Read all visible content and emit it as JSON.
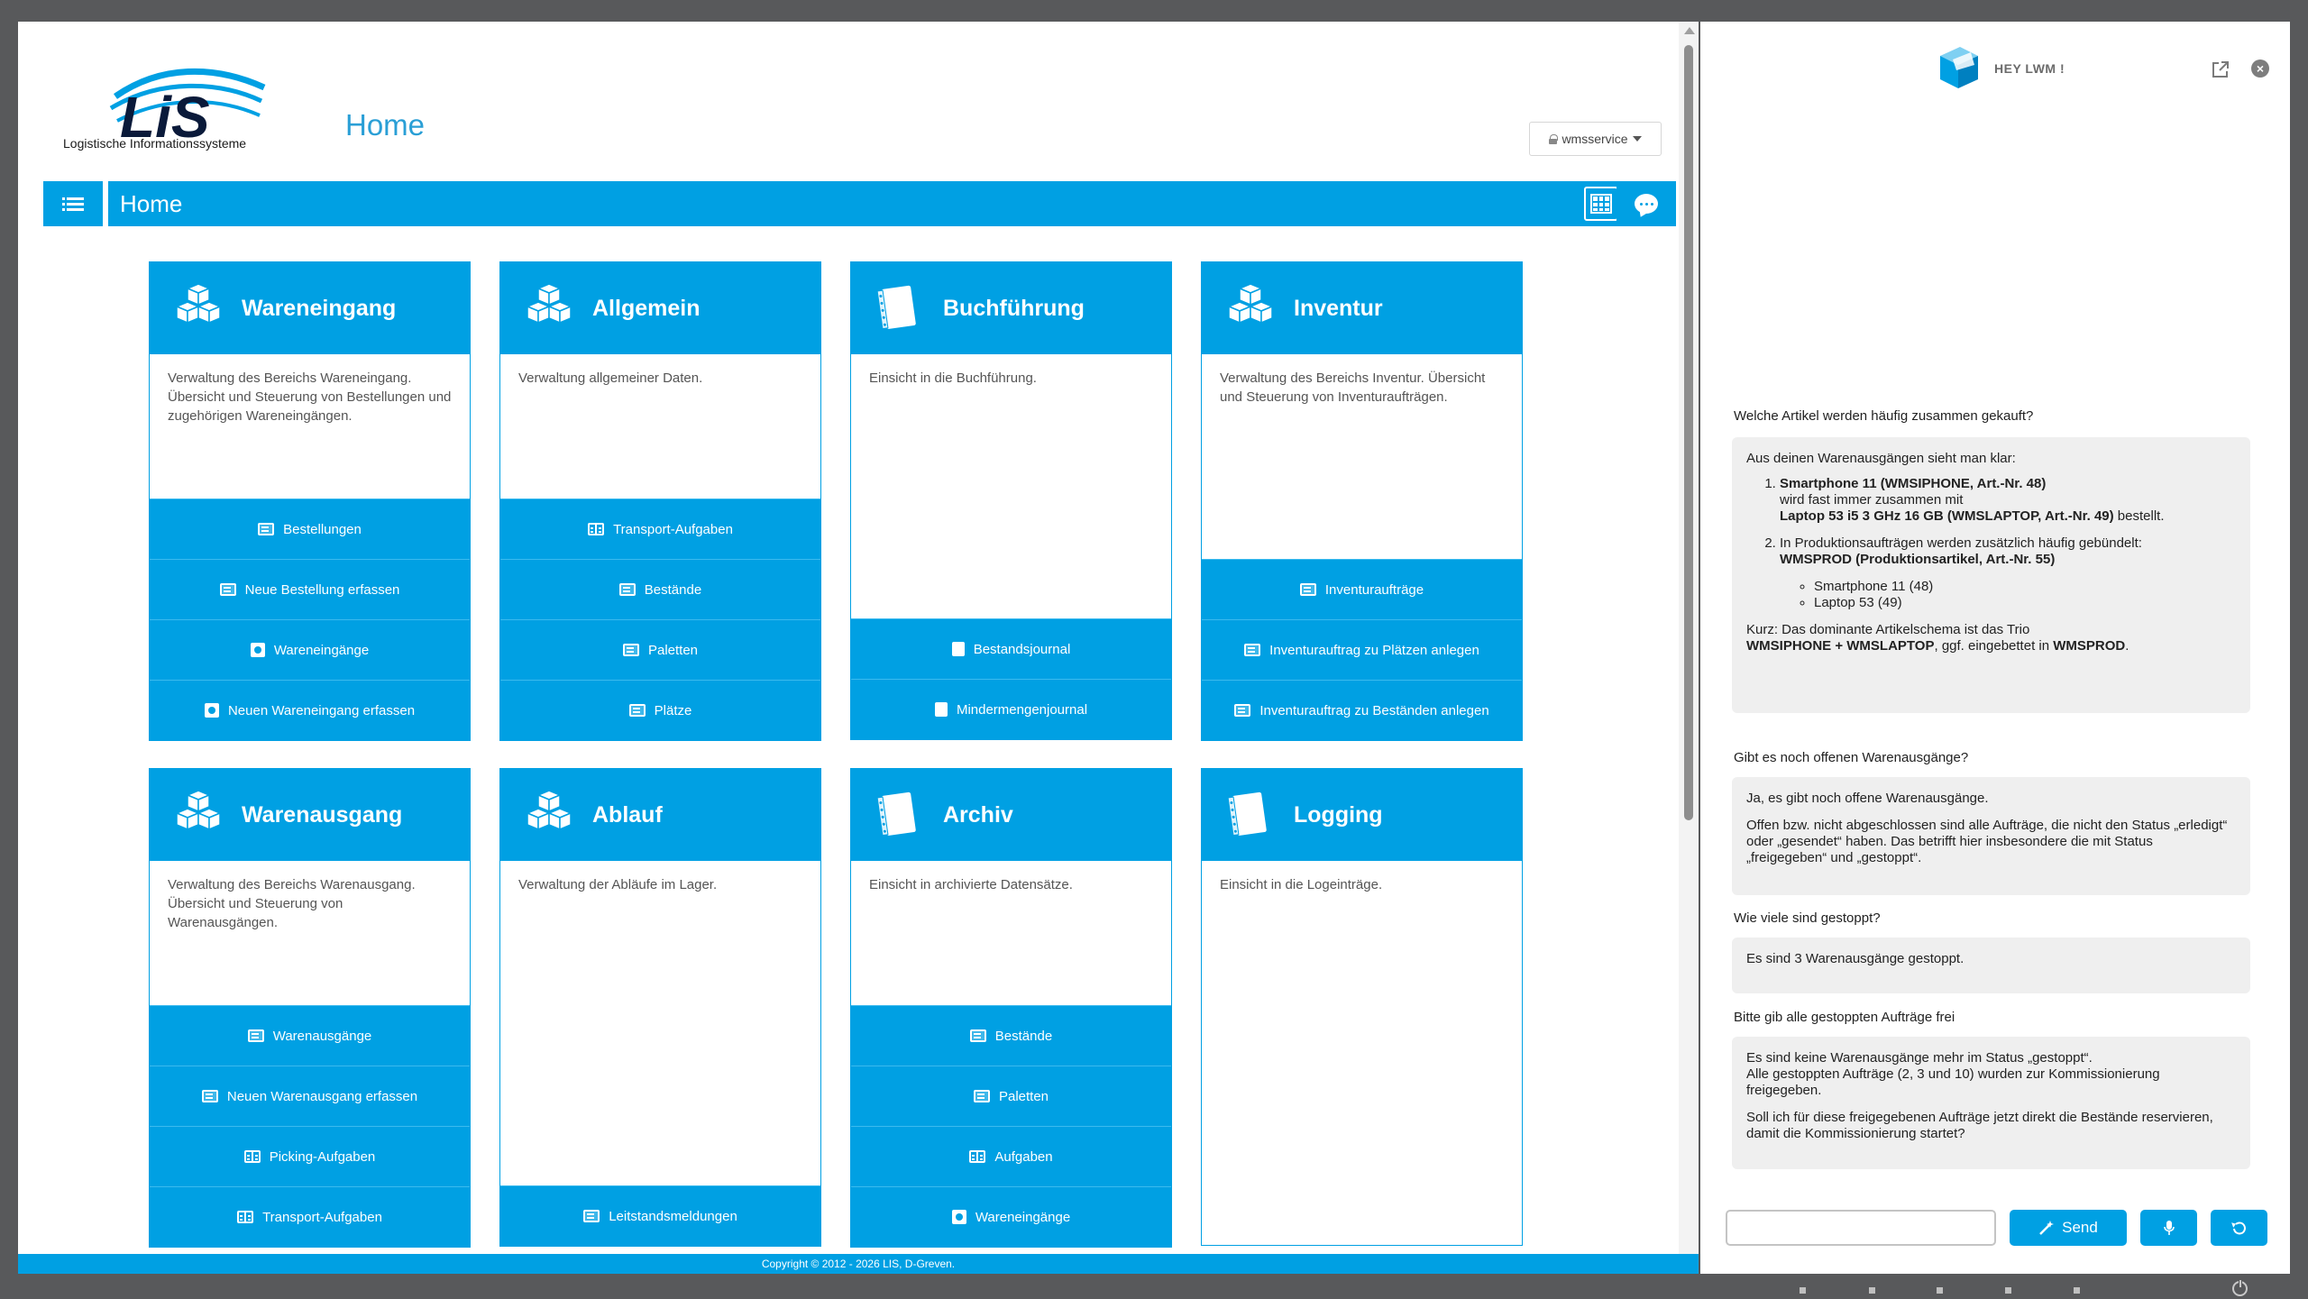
{
  "app": {
    "logo_text": "LiS",
    "logo_subtitle": "Logistische Informationssysteme",
    "page_title": "Home",
    "user": "wmsservice",
    "header_title": "Home",
    "footer": "Copyright © 2012 - 2026 LIS, D-Greven.",
    "accent_color": "#00a0e3"
  },
  "tiles": [
    {
      "title": "Wareneingang",
      "icon": "boxes-icon",
      "desc": "Verwaltung des Bereichs Wareneingang. Übersicht und Steuerung von Bestellungen und zugehörigen Wareneingängen.",
      "links": [
        {
          "label": "Bestellungen",
          "icon": "doc"
        },
        {
          "label": "Neue Bestellung erfassen",
          "icon": "doc"
        },
        {
          "label": "Wareneingänge",
          "icon": "puzzle"
        },
        {
          "label": "Neuen Wareneingang erfassen",
          "icon": "puzzle"
        }
      ]
    },
    {
      "title": "Allgemein",
      "icon": "boxes-icon",
      "desc": "Verwaltung allgemeiner Daten.",
      "links": [
        {
          "label": "Transport-Aufgaben",
          "icon": "book"
        },
        {
          "label": "Bestände",
          "icon": "doc"
        },
        {
          "label": "Paletten",
          "icon": "doc"
        },
        {
          "label": "Plätze",
          "icon": "doc"
        }
      ]
    },
    {
      "title": "Buchführung",
      "icon": "ledger-icon",
      "desc": "Einsicht in die Buchführung.",
      "links": [
        {
          "label": "Bestandsjournal",
          "icon": "ledger"
        },
        {
          "label": "Mindermengenjournal",
          "icon": "ledger"
        }
      ]
    },
    {
      "title": "Inventur",
      "icon": "boxes-icon",
      "desc": "Verwaltung des Bereichs Inventur. Übersicht und Steuerung von Inventuraufträgen.",
      "links": [
        {
          "label": "Inventuraufträge",
          "icon": "doc"
        },
        {
          "label": "Inventurauftrag zu Plätzen anlegen",
          "icon": "doc"
        },
        {
          "label": "Inventurauftrag zu Beständen anlegen",
          "icon": "doc"
        }
      ]
    },
    {
      "title": "Warenausgang",
      "icon": "boxes-icon",
      "desc": "Verwaltung des Bereichs Warenausgang. Übersicht und Steuerung von Warenausgängen.",
      "links": [
        {
          "label": "Warenausgänge",
          "icon": "doc"
        },
        {
          "label": "Neuen Warenausgang erfassen",
          "icon": "doc"
        },
        {
          "label": "Picking-Aufgaben",
          "icon": "book"
        },
        {
          "label": "Transport-Aufgaben",
          "icon": "book"
        }
      ]
    },
    {
      "title": "Ablauf",
      "icon": "boxes-icon",
      "desc": "Verwaltung der Abläufe im Lager.",
      "links": [
        {
          "label": "Leitstandsmeldungen",
          "icon": "doc"
        }
      ]
    },
    {
      "title": "Archiv",
      "icon": "ledger-icon",
      "desc": "Einsicht in archivierte Datensätze.",
      "links": [
        {
          "label": "Bestände",
          "icon": "doc"
        },
        {
          "label": "Paletten",
          "icon": "doc"
        },
        {
          "label": "Aufgaben",
          "icon": "book"
        },
        {
          "label": "Wareneingänge",
          "icon": "puzzle"
        }
      ]
    },
    {
      "title": "Logging",
      "icon": "ledger-icon",
      "desc": "Einsicht in die Logeinträge.",
      "links": []
    }
  ],
  "chat": {
    "brand": "HEY LWM !",
    "messages": {
      "q1": "Welche Artikel werden häufig zusammen gekauft?",
      "a1_intro": "Aus deinen Warenausgängen sieht man klar:",
      "a1_item1_b1": "Smartphone 11 (WMSIPHONE, Art.-Nr. 48)",
      "a1_item1_t1": "wird fast immer zusammen mit",
      "a1_item1_b2": "Laptop 53 i5 3 GHz 16 GB (WMSLAPTOP, Art.-Nr. 49)",
      "a1_item1_t2": " bestellt.",
      "a1_item2_t1": "In Produktionsaufträgen werden zusätzlich häufig gebündelt:",
      "a1_item2_b1": "WMSPROD (Produktionsartikel, Art.-Nr. 55)",
      "a1_sub1": "Smartphone 11 (48)",
      "a1_sub2": "Laptop 53 (49)",
      "a1_outro_t1": "Kurz: Das dominante Artikelschema ist das Trio",
      "a1_outro_b1": "WMSIPHONE + WMSLAPTOP",
      "a1_outro_t2": ", ggf. eingebettet in ",
      "a1_outro_b2": "WMSPROD",
      "a1_outro_t3": ".",
      "q2": "Gibt es noch offenen Warenausgänge?",
      "a2_p1": "Ja, es gibt noch offene Warenausgänge.",
      "a2_p2": "Offen bzw. nicht abgeschlossen sind alle Aufträge, die nicht den Status „erledigt“ oder „gesendet“ haben. Das betrifft hier insbesondere die mit Status „freigegeben“ und „gestoppt“.",
      "q3": "Wie viele sind gestoppt?",
      "a3": "Es sind 3 Warenausgänge gestoppt.",
      "q4": "Bitte gib alle gestoppten Aufträge frei",
      "a4_p1a": "Es sind keine Warenausgänge mehr im Status „gestoppt“.",
      "a4_p1b": "Alle gestoppten Aufträge (2, 3 und 10) wurden zur Kommissionierung freigegeben.",
      "a4_p2": "Soll ich für diese freigegebenen Aufträge jetzt direkt die Bestände reservieren, damit die Kommissionierung startet?"
    },
    "input_placeholder": "",
    "send_label": "Send"
  }
}
